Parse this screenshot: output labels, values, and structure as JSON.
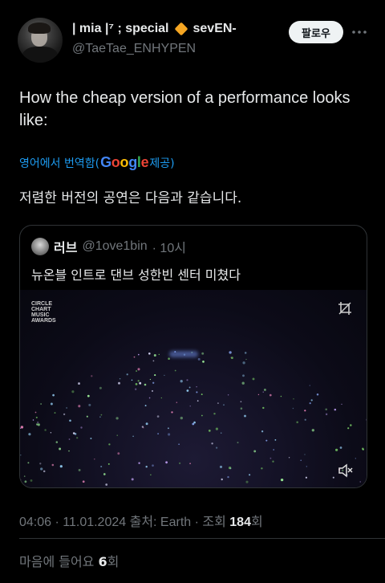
{
  "author": {
    "display_name_pre": "| mia |⁷ ; special",
    "display_name_post": "sevEN-",
    "handle": "@TaeTae_ENHYPEN",
    "badge_icon": "orange-diamond-icon"
  },
  "header": {
    "follow_label": "팔로우",
    "more_icon": "ellipsis-icon"
  },
  "tweet": {
    "text": "How the cheap version of a performance looks like:",
    "translate_prefix": "영어에서 번역함(",
    "translate_google": [
      "G",
      "o",
      "o",
      "g",
      "l",
      "e"
    ],
    "translate_suffix": " 제공)",
    "translated_text": "저렴한 버전의 공연은 다음과 같습니다."
  },
  "quote": {
    "name": "러브",
    "handle": "@1ove1bin",
    "time": "· 10시",
    "text": "뉴온블 인트로 댄브 성한빈 센터 미쳤다",
    "media_logo": "CIRCLE CHART MUSIC AWARDS",
    "crop_icon": "crop-icon",
    "mute_icon": "volume-muted-icon"
  },
  "meta": {
    "timestamp": "04:06 · 11.01.2024 출처: Earth · 조회 ",
    "views": "184",
    "views_suffix": "회"
  },
  "likes": {
    "label": "마음에 들어요 ",
    "count": "6",
    "suffix": "회"
  },
  "colors": {
    "accent": "#1d9bf0",
    "background": "#000000",
    "muted_text": "#71767b",
    "badge": "#f5a623"
  }
}
